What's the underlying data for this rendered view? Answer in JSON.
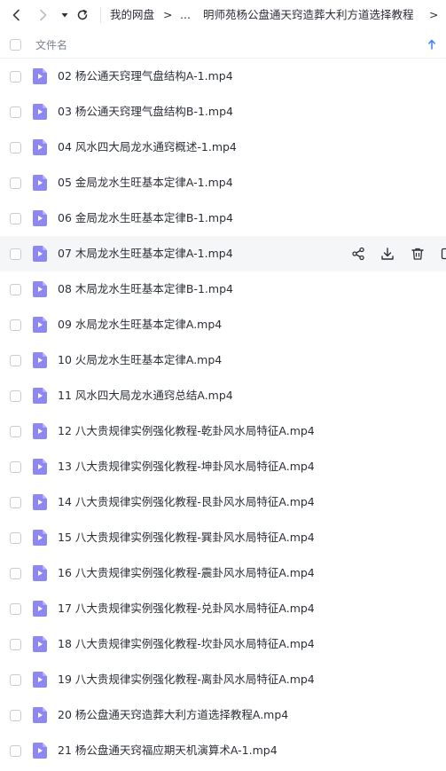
{
  "toolbar": {
    "back_icon": "chevron-left-icon",
    "forward_icon": "chevron-right-icon",
    "history_icon": "caret-down-icon",
    "refresh_icon": "refresh-icon",
    "breadcrumb": [
      {
        "label": "我的网盘"
      },
      {
        "label": "..."
      },
      {
        "label": "明师苑杨公盘通天窍造葬大利方道选择教程"
      }
    ],
    "separator": ">"
  },
  "header": {
    "column_label": "文件名",
    "sort_icon": "sort-up-arrow-icon"
  },
  "colors": {
    "file_icon": "#8d86f3",
    "accent": "#3b7cff",
    "hover_row": "#f5f6f8"
  },
  "files": [
    {
      "name": "02 杨公通天窍理气盘结构A-1.mp4"
    },
    {
      "name": "03 杨公通天窍理气盘结构B-1.mp4"
    },
    {
      "name": "04 风水四大局龙水通窍概述-1.mp4"
    },
    {
      "name": "05 金局龙水生旺基本定律A-1.mp4"
    },
    {
      "name": "06 金局龙水生旺基本定律B-1.mp4"
    },
    {
      "name": "07 木局龙水生旺基本定律A-1.mp4",
      "hovered": true
    },
    {
      "name": "08 木局龙水生旺基本定律B-1.mp4"
    },
    {
      "name": "09 水局龙水生旺基本定律A.mp4"
    },
    {
      "name": "10 火局龙水生旺基本定律A.mp4"
    },
    {
      "name": "11 风水四大局龙水通窍总结A.mp4"
    },
    {
      "name": "12 八大贵规律实例强化教程-乾卦风水局特征A.mp4"
    },
    {
      "name": "13 八大贵规律实例强化教程-坤卦风水局特征A.mp4"
    },
    {
      "name": "14 八大贵规律实例强化教程-艮卦风水局特征A.mp4"
    },
    {
      "name": "15 八大贵规律实例强化教程-巽卦风水局特征A.mp4"
    },
    {
      "name": "16 八大贵规律实例强化教程-震卦风水局特征A.mp4"
    },
    {
      "name": "17 八大贵规律实例强化教程-兑卦风水局特征A.mp4"
    },
    {
      "name": "18 八大贵规律实例强化教程-坎卦风水局特征A.mp4"
    },
    {
      "name": "19 八大贵规律实例强化教程-离卦风水局特征A.mp4"
    },
    {
      "name": "20 杨公盘通天窍造葬大利方道选择教程A.mp4"
    },
    {
      "name": "21 杨公盘通天窍福应期天机演算术A-1.mp4"
    }
  ],
  "row_actions": [
    {
      "icon": "share-icon"
    },
    {
      "icon": "download-icon"
    },
    {
      "icon": "trash-icon"
    },
    {
      "icon": "more-icon"
    }
  ]
}
